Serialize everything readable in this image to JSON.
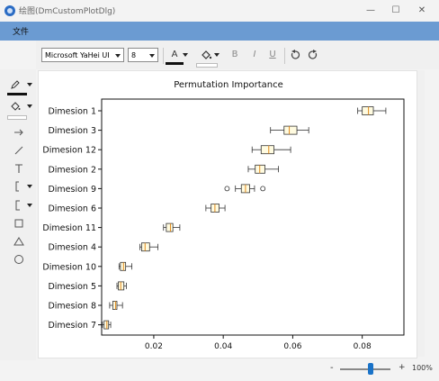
{
  "window": {
    "title": "绘图(DmCustomPlotDlg)"
  },
  "menu": {
    "file_label": "文件"
  },
  "toolbar": {
    "font_family": "Microsoft YaHei UI",
    "font_size": "8",
    "text_color_glyph": "A",
    "bold_glyph": "B",
    "italic_glyph": "I",
    "underline_glyph": "U"
  },
  "sidebar": {
    "tools": [
      "pen",
      "fill",
      "arrow",
      "line",
      "text",
      "bracket",
      "bracket-alt",
      "rectangle",
      "triangle",
      "ellipse"
    ]
  },
  "statusbar": {
    "zoom_minus": "-",
    "zoom_plus": "+",
    "zoom_level": "100%",
    "zoom_value": 0.6
  },
  "chart_data": {
    "type": "boxplot",
    "title": "Permutation Importance",
    "xlabel": "",
    "ylabel": "",
    "xlim": [
      0.005,
      0.092
    ],
    "xticks": [
      0.02,
      0.04,
      0.06,
      0.08
    ],
    "xtick_labels": [
      "0.02",
      "0.04",
      "0.06",
      "0.08"
    ],
    "categories": [
      "Dimesion 1",
      "Dimesion 3",
      "Dimesion 12",
      "Dimesion 2",
      "Dimesion 9",
      "Dimesion 6",
      "Dimesion 11",
      "Dimesion 4",
      "Dimesion 10",
      "Dimesion 5",
      "Dimesion 8",
      "Dimesion 7"
    ],
    "boxes": [
      {
        "whisker_low": 0.0787,
        "q1": 0.08,
        "median": 0.0818,
        "q3": 0.0832,
        "whisker_high": 0.0868,
        "outliers": []
      },
      {
        "whisker_low": 0.0536,
        "q1": 0.0575,
        "median": 0.059,
        "q3": 0.0612,
        "whisker_high": 0.0646,
        "outliers": []
      },
      {
        "whisker_low": 0.0483,
        "q1": 0.0509,
        "median": 0.0531,
        "q3": 0.0546,
        "whisker_high": 0.0594,
        "outliers": []
      },
      {
        "whisker_low": 0.0472,
        "q1": 0.0492,
        "median": 0.0505,
        "q3": 0.052,
        "whisker_high": 0.0559,
        "outliers": []
      },
      {
        "whisker_low": 0.0435,
        "q1": 0.0452,
        "median": 0.0464,
        "q3": 0.0476,
        "whisker_high": 0.049,
        "outliers": [
          0.0411,
          0.0514
        ]
      },
      {
        "whisker_low": 0.035,
        "q1": 0.0365,
        "median": 0.0376,
        "q3": 0.0388,
        "whisker_high": 0.0405,
        "outliers": []
      },
      {
        "whisker_low": 0.0228,
        "q1": 0.0236,
        "median": 0.0248,
        "q3": 0.0255,
        "whisker_high": 0.0275,
        "outliers": []
      },
      {
        "whisker_low": 0.016,
        "q1": 0.0165,
        "median": 0.0175,
        "q3": 0.0188,
        "whisker_high": 0.0212,
        "outliers": []
      },
      {
        "whisker_low": 0.01,
        "q1": 0.0104,
        "median": 0.0113,
        "q3": 0.0119,
        "whisker_high": 0.0137,
        "outliers": []
      },
      {
        "whisker_low": 0.0094,
        "q1": 0.0098,
        "median": 0.0105,
        "q3": 0.0114,
        "whisker_high": 0.0121,
        "outliers": []
      },
      {
        "whisker_low": 0.0073,
        "q1": 0.0082,
        "median": 0.009,
        "q3": 0.0094,
        "whisker_high": 0.011,
        "outliers": []
      },
      {
        "whisker_low": 0.0052,
        "q1": 0.0057,
        "median": 0.0065,
        "q3": 0.007,
        "whisker_high": 0.0076,
        "outliers": []
      }
    ],
    "colors": {
      "box_fill": "#fffbe0",
      "box_edge": "#333333",
      "median": "#e08a1e",
      "whisker": "#333333"
    },
    "grid": false,
    "legend": "none"
  }
}
